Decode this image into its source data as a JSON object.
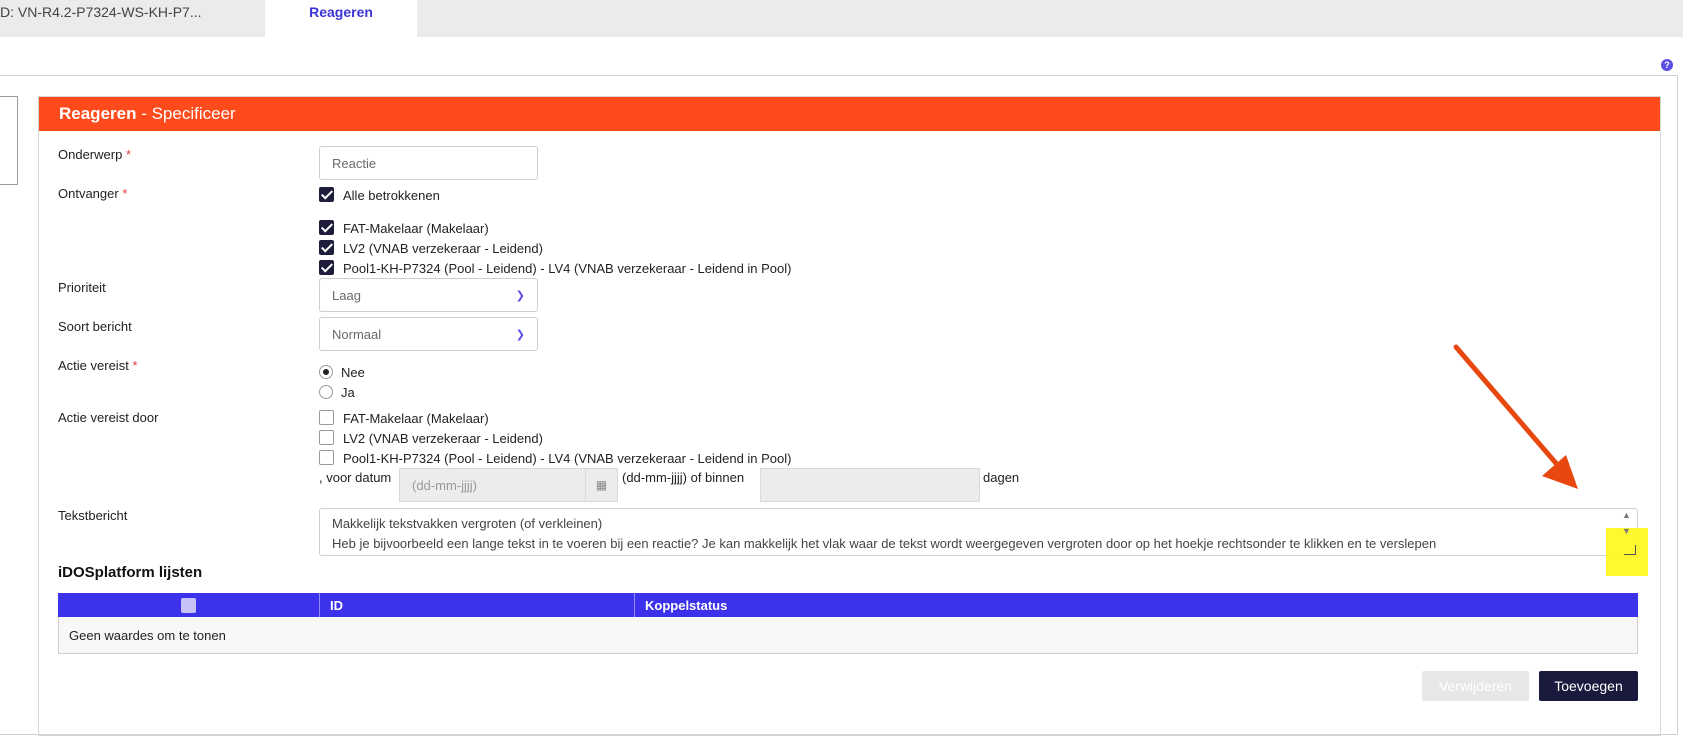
{
  "tabs": {
    "inactive_label": "D: VN-R4.2-P7324-WS-KH-P7...",
    "active_label": "Reageren"
  },
  "help_glyph": "?",
  "panel": {
    "title_strong": "Reageren",
    "title_rest": " - Specificeer"
  },
  "form": {
    "onderwerp": {
      "label": "Onderwerp",
      "required": "*",
      "value": "Reactie"
    },
    "ontvanger": {
      "label": "Ontvanger",
      "required": "*",
      "all_label": "Alle betrokkenen",
      "options": [
        "FAT-Makelaar (Makelaar)",
        "LV2 (VNAB verzekeraar - Leidend)",
        "Pool1-KH-P7324 (Pool - Leidend) - LV4 (VNAB verzekeraar - Leidend in Pool)"
      ]
    },
    "prioriteit": {
      "label": "Prioriteit",
      "value": "Laag"
    },
    "soort_bericht": {
      "label": "Soort bericht",
      "value": "Normaal"
    },
    "actie_vereist": {
      "label": "Actie vereist",
      "required": "*",
      "options": [
        "Nee",
        "Ja"
      ],
      "selected": "Nee"
    },
    "actie_vereist_door": {
      "label": "Actie vereist door",
      "options": [
        "FAT-Makelaar (Makelaar)",
        "LV2 (VNAB verzekeraar - Leidend)",
        "Pool1-KH-P7324 (Pool - Leidend) - LV4 (VNAB verzekeraar - Leidend in Pool)"
      ],
      "voor_datum": ", voor datum",
      "date_placeholder": "(dd-mm-jjjj)",
      "date_hint": "(dd-mm-jjjj) of binnen",
      "dagen": "dagen"
    },
    "tekstbericht": {
      "label": "Tekstbericht",
      "line1": "Makkelijk tekstvakken vergroten (of verkleinen)",
      "line2": "Heb je bijvoorbeeld een lange tekst in te voeren bij een reactie? Je kan makkelijk het vlak waar de tekst wordt weergegeven vergroten door op het hoekje rechtsonder te klikken en te verslepen"
    }
  },
  "lijsten": {
    "title": "iDOSplatform lijsten",
    "columns": [
      "ID",
      "Koppelstatus"
    ],
    "empty_text": "Geen waardes om te tonen"
  },
  "buttons": {
    "verwijderen": "Verwijderen",
    "toevoegen": "Toevoegen"
  },
  "colors": {
    "header_orange": "#ff4a1c",
    "accent_purple": "#3c32eb",
    "annotation_arrow": "#e8470f",
    "highlight_yellow": "#fff71a"
  }
}
